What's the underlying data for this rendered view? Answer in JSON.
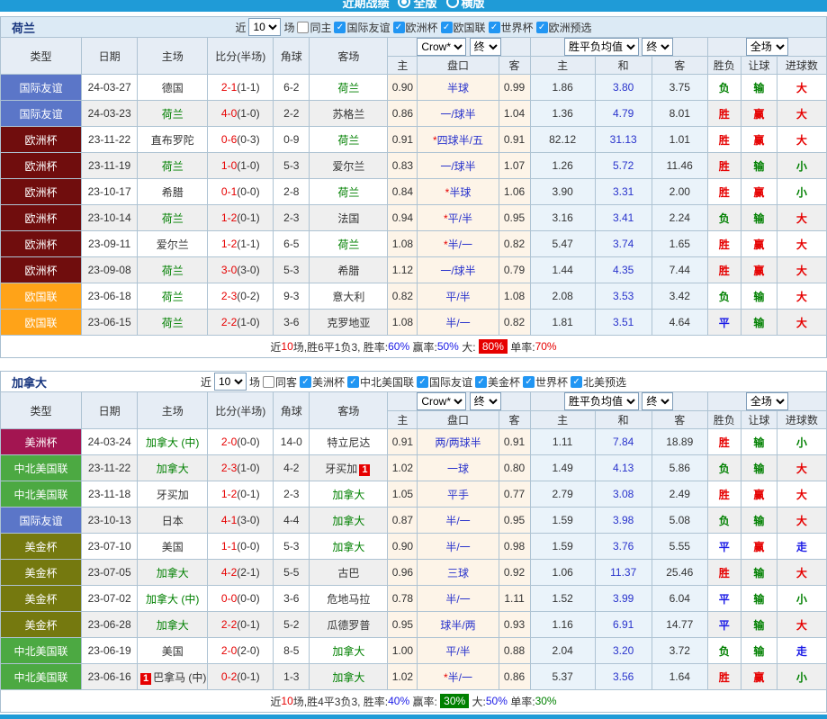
{
  "top_bar": {
    "title": "近期战绩",
    "options": [
      {
        "label": "全版",
        "selected": true
      },
      {
        "label": "横版",
        "selected": false
      }
    ]
  },
  "colors": {
    "topbar_blue": "#1F9BD7",
    "red": "#E60000",
    "green": "#008000",
    "blue": "#1A1AE6",
    "white": "#FFFFFF",
    "black": "#333333",
    "handicap_blue": "#2933CC"
  },
  "league_colors": {
    "国际友谊": "#5B76C8",
    "欧洲杯": "#700D0D",
    "欧国联": "#FFA318",
    "美洲杯": "#A31551",
    "中北美国联": "#4CA942",
    "美金杯": "#75790F"
  },
  "result_colors": {
    "胜": "red",
    "平": "blue",
    "负": "green",
    "赢": "red",
    "输": "green",
    "走": "blue",
    "大": "red",
    "小": "green"
  },
  "filter": {
    "near": "近",
    "count": "10",
    "unit": "场"
  },
  "table_header": {
    "cols": [
      "类型",
      "日期",
      "主场",
      "比分(半场)",
      "角球",
      "客场"
    ],
    "sub": [
      "主",
      "盘口",
      "客",
      "主",
      "和",
      "客",
      "胜负",
      "让球",
      "进球数"
    ],
    "odds_source": "Crow*",
    "odds_final": "终",
    "avg_label": "胜平负均值",
    "avg_final": "终",
    "scope": "全场"
  },
  "sections": [
    {
      "title": "荷兰",
      "header_bg": "#DCEAF5",
      "same_label": "同主",
      "same_checked": false,
      "leagues": [
        "国际友谊",
        "欧洲杯",
        "欧国联",
        "世界杯",
        "欧洲预选"
      ],
      "rows": [
        {
          "league": "国际友谊",
          "date": "24-03-27",
          "home": "德国",
          "home_green": false,
          "score": "2-1",
          "half": "(1-1)",
          "corners": "6-2",
          "away": "荷兰",
          "away_green": true,
          "o_home": "0.90",
          "star": false,
          "handicap": "半球",
          "o_away": "0.99",
          "avg_h": "1.86",
          "avg_d": "3.80",
          "avg_a": "3.75",
          "wdl": "负",
          "let": "输",
          "goals": "大"
        },
        {
          "league": "国际友谊",
          "date": "24-03-23",
          "home": "荷兰",
          "home_green": true,
          "score": "4-0",
          "half": "(1-0)",
          "corners": "2-2",
          "away": "苏格兰",
          "away_green": false,
          "o_home": "0.86",
          "star": false,
          "handicap": "一/球半",
          "o_away": "1.04",
          "avg_h": "1.36",
          "avg_d": "4.79",
          "avg_a": "8.01",
          "wdl": "胜",
          "let": "赢",
          "goals": "大"
        },
        {
          "league": "欧洲杯",
          "date": "23-11-22",
          "home": "直布罗陀",
          "home_green": false,
          "score": "0-6",
          "half": "(0-3)",
          "corners": "0-9",
          "away": "荷兰",
          "away_green": true,
          "o_home": "0.91",
          "star": true,
          "handicap": "四球半/五",
          "o_away": "0.91",
          "avg_h": "82.12",
          "avg_d": "31.13",
          "avg_a": "1.01",
          "wdl": "胜",
          "let": "赢",
          "goals": "大"
        },
        {
          "league": "欧洲杯",
          "date": "23-11-19",
          "home": "荷兰",
          "home_green": true,
          "score": "1-0",
          "half": "(1-0)",
          "corners": "5-3",
          "away": "爱尔兰",
          "away_green": false,
          "o_home": "0.83",
          "star": false,
          "handicap": "一/球半",
          "o_away": "1.07",
          "avg_h": "1.26",
          "avg_d": "5.72",
          "avg_a": "11.46",
          "wdl": "胜",
          "let": "输",
          "goals": "小"
        },
        {
          "league": "欧洲杯",
          "date": "23-10-17",
          "home": "希腊",
          "home_green": false,
          "score": "0-1",
          "half": "(0-0)",
          "corners": "2-8",
          "away": "荷兰",
          "away_green": true,
          "o_home": "0.84",
          "star": true,
          "handicap": "半球",
          "o_away": "1.06",
          "avg_h": "3.90",
          "avg_d": "3.31",
          "avg_a": "2.00",
          "wdl": "胜",
          "let": "赢",
          "goals": "小"
        },
        {
          "league": "欧洲杯",
          "date": "23-10-14",
          "home": "荷兰",
          "home_green": true,
          "score": "1-2",
          "half": "(0-1)",
          "corners": "2-3",
          "away": "法国",
          "away_green": false,
          "o_home": "0.94",
          "star": true,
          "handicap": "平/半",
          "o_away": "0.95",
          "avg_h": "3.16",
          "avg_d": "3.41",
          "avg_a": "2.24",
          "wdl": "负",
          "let": "输",
          "goals": "大"
        },
        {
          "league": "欧洲杯",
          "date": "23-09-11",
          "home": "爱尔兰",
          "home_green": false,
          "score": "1-2",
          "half": "(1-1)",
          "corners": "6-5",
          "away": "荷兰",
          "away_green": true,
          "o_home": "1.08",
          "star": true,
          "handicap": "半/一",
          "o_away": "0.82",
          "avg_h": "5.47",
          "avg_d": "3.74",
          "avg_a": "1.65",
          "wdl": "胜",
          "let": "赢",
          "goals": "大"
        },
        {
          "league": "欧洲杯",
          "date": "23-09-08",
          "home": "荷兰",
          "home_green": true,
          "score": "3-0",
          "half": "(3-0)",
          "corners": "5-3",
          "away": "希腊",
          "away_green": false,
          "o_home": "1.12",
          "star": false,
          "handicap": "一/球半",
          "o_away": "0.79",
          "avg_h": "1.44",
          "avg_d": "4.35",
          "avg_a": "7.44",
          "wdl": "胜",
          "let": "赢",
          "goals": "大"
        },
        {
          "league": "欧国联",
          "date": "23-06-18",
          "home": "荷兰",
          "home_green": true,
          "score": "2-3",
          "half": "(0-2)",
          "corners": "9-3",
          "away": "意大利",
          "away_green": false,
          "o_home": "0.82",
          "star": false,
          "handicap": "平/半",
          "o_away": "1.08",
          "avg_h": "2.08",
          "avg_d": "3.53",
          "avg_a": "3.42",
          "wdl": "负",
          "let": "输",
          "goals": "大"
        },
        {
          "league": "欧国联",
          "date": "23-06-15",
          "home": "荷兰",
          "home_green": true,
          "score": "2-2",
          "half": "(1-0)",
          "corners": "3-6",
          "away": "克罗地亚",
          "away_green": false,
          "o_home": "1.08",
          "star": false,
          "handicap": "半/一",
          "o_away": "0.82",
          "avg_h": "1.81",
          "avg_d": "3.51",
          "avg_a": "4.64",
          "wdl": "平",
          "let": "输",
          "goals": "大"
        }
      ],
      "summary": [
        {
          "t": "近"
        },
        {
          "t": "10",
          "c": "red"
        },
        {
          "t": "场,胜6平1负3, 胜率:"
        },
        {
          "t": "60%",
          "c": "blue"
        },
        {
          "t": " 赢率:"
        },
        {
          "t": "50%",
          "c": "blue"
        },
        {
          "t": " 大: "
        },
        {
          "t": "80%",
          "c": "white",
          "bg": "red"
        },
        {
          "t": " 单率:"
        },
        {
          "t": "70%",
          "c": "red"
        }
      ]
    },
    {
      "title": "加拿大",
      "header_bg": "#FFFFFF",
      "same_label": "同客",
      "same_checked": false,
      "leagues": [
        "美洲杯",
        "中北美国联",
        "国际友谊",
        "美金杯",
        "世界杯",
        "北美预选"
      ],
      "rows": [
        {
          "league": "美洲杯",
          "date": "24-03-24",
          "home": "加拿大 (中)",
          "home_green": true,
          "score": "2-0",
          "half": "(0-0)",
          "corners": "14-0",
          "away": "特立尼达",
          "away_green": false,
          "o_home": "0.91",
          "star": false,
          "handicap": "两/两球半",
          "o_away": "0.91",
          "avg_h": "1.11",
          "avg_d": "7.84",
          "avg_a": "18.89",
          "wdl": "胜",
          "let": "输",
          "goals": "小"
        },
        {
          "league": "中北美国联",
          "date": "23-11-22",
          "home": "加拿大",
          "home_green": true,
          "score": "2-3",
          "half": "(1-0)",
          "corners": "4-2",
          "away": "牙买加",
          "away_green": false,
          "away_badge": "1",
          "o_home": "1.02",
          "star": false,
          "handicap": "一球",
          "o_away": "0.80",
          "avg_h": "1.49",
          "avg_d": "4.13",
          "avg_a": "5.86",
          "wdl": "负",
          "let": "输",
          "goals": "大"
        },
        {
          "league": "中北美国联",
          "date": "23-11-18",
          "home": "牙买加",
          "home_green": false,
          "score": "1-2",
          "half": "(0-1)",
          "corners": "2-3",
          "away": "加拿大",
          "away_green": true,
          "o_home": "1.05",
          "star": false,
          "handicap": "平手",
          "o_away": "0.77",
          "avg_h": "2.79",
          "avg_d": "3.08",
          "avg_a": "2.49",
          "wdl": "胜",
          "let": "赢",
          "goals": "大"
        },
        {
          "league": "国际友谊",
          "date": "23-10-13",
          "home": "日本",
          "home_green": false,
          "score": "4-1",
          "half": "(3-0)",
          "corners": "4-4",
          "away": "加拿大",
          "away_green": true,
          "o_home": "0.87",
          "star": false,
          "handicap": "半/一",
          "o_away": "0.95",
          "avg_h": "1.59",
          "avg_d": "3.98",
          "avg_a": "5.08",
          "wdl": "负",
          "let": "输",
          "goals": "大"
        },
        {
          "league": "美金杯",
          "date": "23-07-10",
          "home": "美国",
          "home_green": false,
          "score": "1-1",
          "half": "(0-0)",
          "corners": "5-3",
          "away": "加拿大",
          "away_green": true,
          "o_home": "0.90",
          "star": false,
          "handicap": "半/一",
          "o_away": "0.98",
          "avg_h": "1.59",
          "avg_d": "3.76",
          "avg_a": "5.55",
          "wdl": "平",
          "let": "赢",
          "goals": "走"
        },
        {
          "league": "美金杯",
          "date": "23-07-05",
          "home": "加拿大",
          "home_green": true,
          "score": "4-2",
          "half": "(2-1)",
          "corners": "5-5",
          "away": "古巴",
          "away_green": false,
          "o_home": "0.96",
          "star": false,
          "handicap": "三球",
          "o_away": "0.92",
          "avg_h": "1.06",
          "avg_d": "11.37",
          "avg_a": "25.46",
          "wdl": "胜",
          "let": "输",
          "goals": "大"
        },
        {
          "league": "美金杯",
          "date": "23-07-02",
          "home": "加拿大 (中)",
          "home_green": true,
          "score": "0-0",
          "half": "(0-0)",
          "corners": "3-6",
          "away": "危地马拉",
          "away_green": false,
          "o_home": "0.78",
          "star": false,
          "handicap": "半/一",
          "o_away": "1.11",
          "avg_h": "1.52",
          "avg_d": "3.99",
          "avg_a": "6.04",
          "wdl": "平",
          "let": "输",
          "goals": "小"
        },
        {
          "league": "美金杯",
          "date": "23-06-28",
          "home": "加拿大",
          "home_green": true,
          "score": "2-2",
          "half": "(0-1)",
          "corners": "5-2",
          "away": "瓜德罗普",
          "away_green": false,
          "o_home": "0.95",
          "star": false,
          "handicap": "球半/两",
          "o_away": "0.93",
          "avg_h": "1.16",
          "avg_d": "6.91",
          "avg_a": "14.77",
          "wdl": "平",
          "let": "输",
          "goals": "大"
        },
        {
          "league": "中北美国联",
          "date": "23-06-19",
          "home": "美国",
          "home_green": false,
          "score": "2-0",
          "half": "(2-0)",
          "corners": "8-5",
          "away": "加拿大",
          "away_green": true,
          "o_home": "1.00",
          "star": false,
          "handicap": "平/半",
          "o_away": "0.88",
          "avg_h": "2.04",
          "avg_d": "3.20",
          "avg_a": "3.72",
          "wdl": "负",
          "let": "输",
          "goals": "走"
        },
        {
          "league": "中北美国联",
          "date": "23-06-16",
          "home": "巴拿马 (中)",
          "home_green": false,
          "home_badge": "1",
          "home_badge_pos": "before",
          "score": "0-2",
          "half": "(0-1)",
          "corners": "1-3",
          "away": "加拿大",
          "away_green": true,
          "o_home": "1.02",
          "star": true,
          "handicap": "半/一",
          "o_away": "0.86",
          "avg_h": "5.37",
          "avg_d": "3.56",
          "avg_a": "1.64",
          "wdl": "胜",
          "let": "赢",
          "goals": "小"
        }
      ],
      "summary": [
        {
          "t": "近"
        },
        {
          "t": "10",
          "c": "red"
        },
        {
          "t": "场,胜4平3负3, 胜率:"
        },
        {
          "t": "40%",
          "c": "blue"
        },
        {
          "t": " 赢率: "
        },
        {
          "t": "30%",
          "c": "white",
          "bg": "green"
        },
        {
          "t": " 大:"
        },
        {
          "t": "50%",
          "c": "blue"
        },
        {
          "t": " 单率:"
        },
        {
          "t": "30%",
          "c": "green"
        }
      ]
    }
  ]
}
